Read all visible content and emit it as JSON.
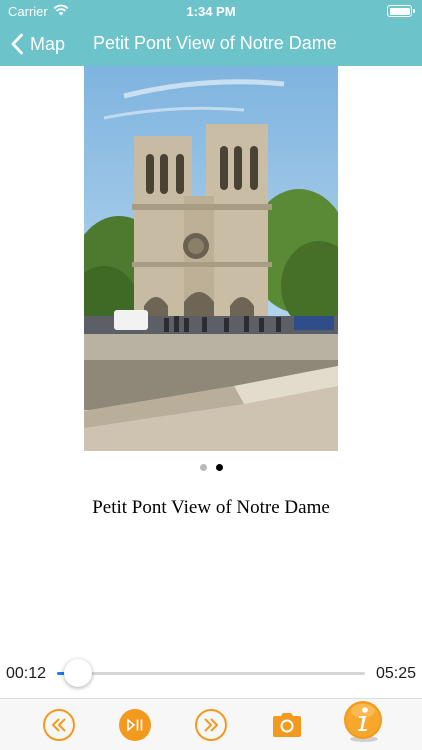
{
  "status_bar": {
    "carrier": "Carrier",
    "time": "1:34 PM"
  },
  "nav": {
    "back_label": "Map",
    "title": "Petit Pont View of Notre Dame"
  },
  "carousel": {
    "page_count": 2,
    "current_page": 2
  },
  "caption": "Petit Pont View of Notre Dame",
  "player": {
    "elapsed": "00:12",
    "total": "05:25",
    "progress_fraction": 0.037
  },
  "toolbar": {
    "icons": [
      "rewind-icon",
      "play-pause-icon",
      "fast-forward-icon",
      "camera-icon",
      "info-icon"
    ]
  },
  "colors": {
    "nav_background": "#6cc3c9",
    "accent_orange": "#f39a1e",
    "progress_blue": "#1e7cf2"
  }
}
